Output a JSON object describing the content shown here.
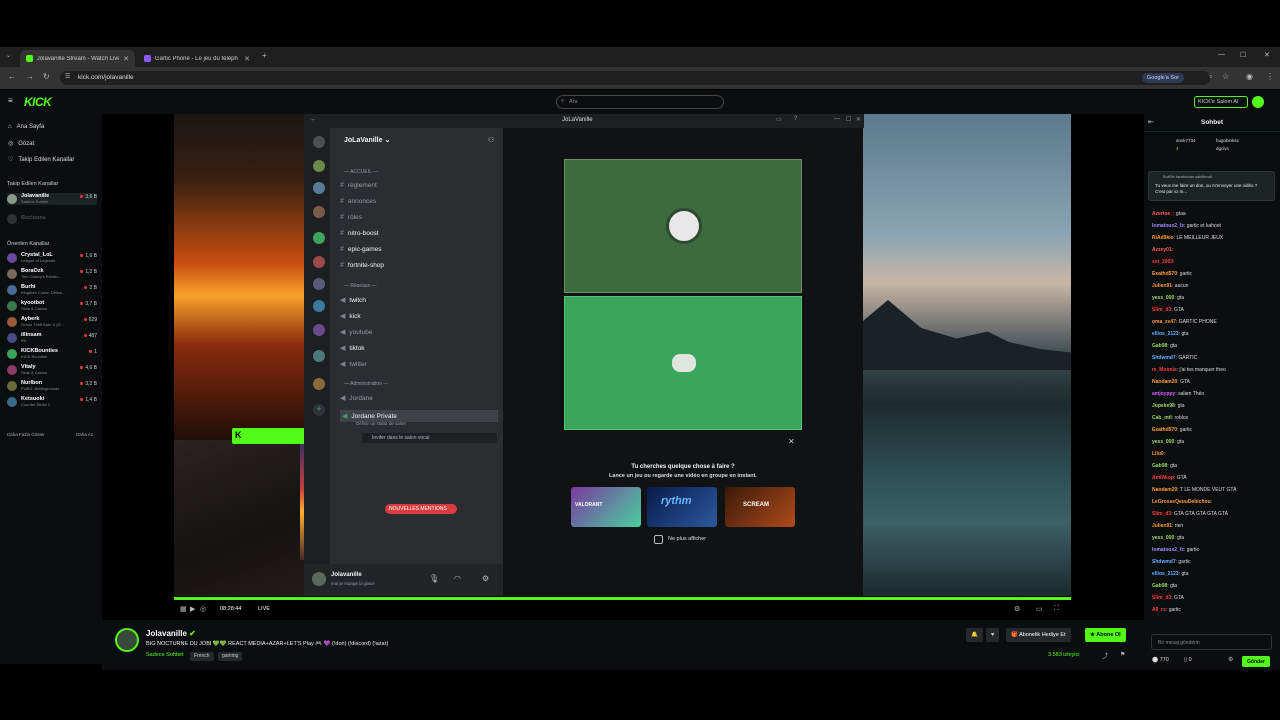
{
  "browser": {
    "tabs": [
      {
        "title": "Jolavanille Stream - Watch Live",
        "active": true
      },
      {
        "title": "Gartic Phone - Le jeu du téléph",
        "active": false
      }
    ],
    "url": "kick.com/jolavanille",
    "google_pill": "Google'a Sor"
  },
  "header": {
    "logo": "KICK",
    "search_placeholder": "Ara",
    "ai_button": "KICK'e Salom AI"
  },
  "sidebar": {
    "nav": [
      {
        "label": "Ana Sayfa",
        "icon": "home-icon"
      },
      {
        "label": "Gözat",
        "icon": "compass-icon"
      },
      {
        "label": "Takip Edilen Kanallar",
        "icon": "heart-icon"
      }
    ],
    "followed_title": "Takip Edilen Kanallar",
    "followed": [
      {
        "name": "Jolavanille",
        "game": "Sadece Sohbet",
        "viewers": "3,6 B"
      },
      {
        "name": "Bsclouns",
        "game": "",
        "viewers": ""
      }
    ],
    "recommended_title": "Önerilen Kanallar",
    "recommended": [
      {
        "name": "Crystal_LoL",
        "game": "League of Legends",
        "viewers": "1,6 B"
      },
      {
        "name": "BoraOzk",
        "game": "Tom Clancy's Rainbo...",
        "viewers": "1,2 B"
      },
      {
        "name": "Burhi",
        "game": "Kingdom Come: Delive...",
        "viewers": "2 B"
      },
      {
        "name": "kyootbot",
        "game": "Slots & Casino",
        "viewers": "3,7 B"
      },
      {
        "name": "Ayberk",
        "game": "Grand Theft Auto V (G...",
        "viewers": "629"
      },
      {
        "name": "illinsam",
        "game": "IRL",
        "viewers": "487"
      },
      {
        "name": "KICKBounties",
        "game": "KICK Bounties",
        "viewers": "1"
      },
      {
        "name": "Vitaly",
        "game": "Slots & Casino",
        "viewers": "4,6 B"
      },
      {
        "name": "Nurlbon",
        "game": "PUBG: Battlegrounds",
        "viewers": "3,2 B"
      },
      {
        "name": "Ketsuoki",
        "game": "Counter-Strike 2",
        "viewers": "1,4 B"
      }
    ],
    "show_more": "Daha Fazla Göster",
    "show_less": "Daha Az"
  },
  "discord": {
    "window_title": "JoLaVanille",
    "server_name": "JoLaVanille",
    "categories": [
      "ACCUEIL",
      "Réseaux",
      "Administration"
    ],
    "channels_accueil": [
      "règlement",
      "annonces",
      "rôles",
      "nitro-boost",
      "epic-games",
      "fortnite-shop"
    ],
    "channels_reseaux": [
      "twitch",
      "kick",
      "youtube",
      "tiktok",
      "twitter"
    ],
    "channels_admin": [
      "Jordane",
      "Jordane Private"
    ],
    "status_hint": "Définir un statut de salon",
    "invite": "Inviter dans le salon vocal",
    "new_mentions": "NOUVELLES MENTIONS",
    "voice_user": "Jolavanille",
    "voice_status": "moi je mange la glace",
    "prompt_title": "Tu cherches quelque chose à faire ?",
    "prompt_sub": "Lance un jeu ou regarde une vidéo en groupe en instant.",
    "dont_show": "Ne plus afficher",
    "games": [
      "VALORANT",
      "rythm",
      "SCREAM"
    ]
  },
  "player": {
    "time": "08:28:44",
    "live": "LIVE"
  },
  "stream": {
    "channel": "Jolavanille",
    "title": "BIG NOCTURNE DU JOBI 💚💚 REACT MEDIA+AZAR+LET'S Play 🎮 💜 (!don) (!discord) (!azar)",
    "category": "Sadece Sohbet",
    "tags": [
      "French",
      "gaming"
    ],
    "viewers": "3.583 izleyici",
    "gift_button": "Abonelik Hediye Et",
    "subscribe_button": "Abone Ol"
  },
  "chat": {
    "title": "Sohbet",
    "top_gifters": [
      {
        "name": "ansk7734",
        "count": "4"
      },
      {
        "name": "hugobinkss",
        "count": "3"
      },
      {
        "name": "dgcivs",
        "count": "2"
      }
    ],
    "pinned_by": "BotRix tarafından sabitlendi",
    "pinned_text": "Tu veux me faire un don, ou m'envoyer une vidéo ? C'est par ici m...",
    "messages": [
      {
        "user": "Azertoe_",
        "text": "gtaa",
        "color": "#ff5c5c"
      },
      {
        "user": "lomatoux2_fz",
        "text": "gartic et kahoot",
        "color": "#a48bff"
      },
      {
        "user": "RiAd9kio",
        "text": "LE MEILLEUR JEUX",
        "color": "#ff9a3c"
      },
      {
        "user": "Azzey01",
        "text": "",
        "color": "#ff5c5c"
      },
      {
        "user": "sxt_2003",
        "text": "",
        "color": "#ff3c3c"
      },
      {
        "user": "Exathd570",
        "text": "gartic",
        "color": "#ff9a3c"
      },
      {
        "user": "Julien91",
        "text": "aucun",
        "color": "#ff9a3c"
      },
      {
        "user": "yess_000",
        "text": "gta",
        "color": "#9bd86e"
      },
      {
        "user": "Slim_d3",
        "text": "GTA",
        "color": "#ff3c3c"
      },
      {
        "user": "oma_zs47",
        "text": "GARTIC PHONE",
        "color": "#ff9a3c"
      },
      {
        "user": "ellios_2123",
        "text": "gta",
        "color": "#6ab0ff"
      },
      {
        "user": "Gab98",
        "text": "gta",
        "color": "#9bd86e"
      },
      {
        "user": "Shdwmd7",
        "text": "GARTIC",
        "color": "#6ab0ff"
      },
      {
        "user": "m_Moonie",
        "text": "j'ai tes manquer theo",
        "color": "#ff3c3c"
      },
      {
        "user": "Naodam20",
        "text": "GTA",
        "color": "#ff9a3c"
      },
      {
        "user": "amjoyppy",
        "text": "salam Théo",
        "color": "#d45cff"
      },
      {
        "user": "Jupeke98",
        "text": "gta",
        "color": "#9bd86e"
      },
      {
        "user": "Cab_mtl",
        "text": "roblox",
        "color": "#9bd86e"
      },
      {
        "user": "Exathd570",
        "text": "gartic",
        "color": "#ff9a3c"
      },
      {
        "user": "yess_000",
        "text": "gta",
        "color": "#9bd86e"
      },
      {
        "user": "Lilu0",
        "text": "",
        "color": "#ff9a3c"
      },
      {
        "user": "Gab98",
        "text": "gta",
        "color": "#9bd86e"
      },
      {
        "user": "AmIAkop",
        "text": "GTA",
        "color": "#ff3c3c"
      },
      {
        "user": "Naodam20",
        "text": "T LE MONDE VEUT GTA",
        "color": "#ff9a3c"
      },
      {
        "user": "LeGrosseQeuuDebichou",
        "text": "",
        "color": "#ff9a3c"
      },
      {
        "user": "Slim_d3",
        "text": "GTA GTA GTA GTA GTA",
        "color": "#ff3c3c"
      },
      {
        "user": "Julien91",
        "text": "rien",
        "color": "#ff9a3c"
      },
      {
        "user": "yess_000",
        "text": "gta",
        "color": "#9bd86e"
      },
      {
        "user": "lomatoux2_fz",
        "text": "gartic",
        "color": "#a48bff"
      },
      {
        "user": "Shdwmd7",
        "text": "gartic",
        "color": "#6ab0ff"
      },
      {
        "user": "ellios_2123",
        "text": "gta",
        "color": "#6ab0ff"
      },
      {
        "user": "Gab98",
        "text": "gta",
        "color": "#9bd86e"
      },
      {
        "user": "Slim_d3",
        "text": "GTA",
        "color": "#ff3c3c"
      },
      {
        "user": "All_rs",
        "text": "gartic",
        "color": "#ff3c3c"
      }
    ],
    "input_placeholder": "Bir mesaj gönderin",
    "points": "770",
    "balance": "0",
    "send": "Gönder"
  }
}
